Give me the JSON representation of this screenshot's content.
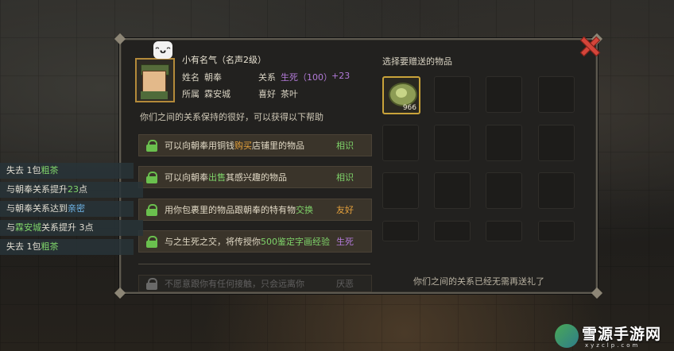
{
  "npc": {
    "reputation": "小有名气（名声2级）",
    "name_label": "姓名",
    "name": "朝奉",
    "relation_label": "关系",
    "relation_level": "生死（100）",
    "relation_delta": "+23",
    "affiliation_label": "所属",
    "affiliation": "霖安城",
    "likes_label": "喜好",
    "likes": "茶叶",
    "emote": "ᵔᴗᵔ"
  },
  "relation_desc": "你们之间的关系保持的很好，可以获得以下帮助",
  "benefits": [
    {
      "pre": "可以向朝奉用铜钱",
      "hl": "购买",
      "post": "店铺里的物品",
      "level": "相识",
      "level_color": "green"
    },
    {
      "pre": "可以向朝奉",
      "hl": "出售",
      "post": "其感兴趣的物品",
      "level": "相识",
      "level_color": "green"
    },
    {
      "pre": "用你包裹里的物品跟朝奉的特有物",
      "hl": "交换",
      "post": "",
      "level": "友好",
      "level_color": "orange"
    },
    {
      "pre": "与之生死之交，将传授你",
      "hl": "500鉴定字画经验",
      "post": "",
      "level": "生死",
      "level_color": "purple"
    },
    {
      "pre": "不愿意跟你有任何接触，只会远离你",
      "hl": "",
      "post": "",
      "level": "厌恶",
      "level_color": "gray"
    }
  ],
  "gift": {
    "title": "选择要赠送的物品",
    "selected_qty": "966",
    "footer": "你们之间的关系已经无需再送礼了"
  },
  "log": [
    {
      "pre": "失去 1包",
      "hl": "粗茶",
      "post": "",
      "color": "green"
    },
    {
      "pre": "与朝奉关系提升",
      "hl": "23",
      "post": "点",
      "color": "green"
    },
    {
      "pre": "与朝奉关系达到",
      "hl": "亲密",
      "post": "",
      "color": "blue"
    },
    {
      "pre": "与",
      "hl": "霖安城",
      "post": "关系提升 3点",
      "color": "green"
    },
    {
      "pre": "失去 1包",
      "hl": "粗茶",
      "post": "",
      "color": "green"
    }
  ],
  "watermark": {
    "title": "雪源手游网",
    "sub": "xyzclp.com"
  }
}
